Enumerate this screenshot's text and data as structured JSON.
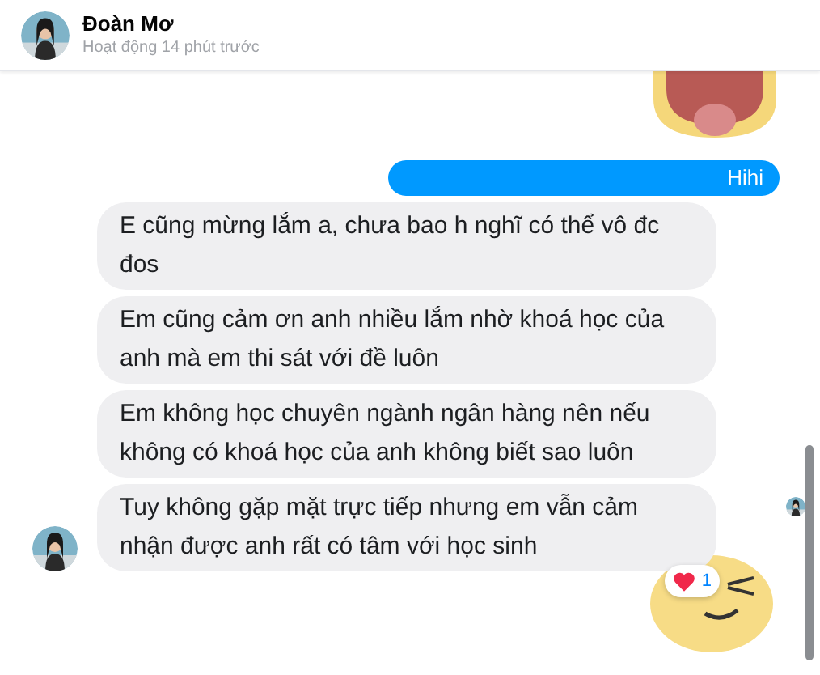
{
  "contact": {
    "name": "Đoàn Mơ",
    "status": "Hoạt động 14 phút trước"
  },
  "messages": [
    {
      "kind": "sticker"
    },
    {
      "kind": "sent",
      "text": "Hihi",
      "seen": false
    },
    {
      "kind": "received",
      "text": "E cũng mừng lắm a, chưa bao h nghĩ có thể vô đc đos",
      "seen": false
    },
    {
      "kind": "received",
      "text": "Em cũng cảm ơn anh nhiều lắm nhờ khoá học của anh mà em thi sát với đề luôn",
      "seen": false
    },
    {
      "kind": "received",
      "text": "Em không học chuyên ngành ngân hàng nên nếu không có khoá học của anh không biết sao luôn",
      "seen": false
    },
    {
      "kind": "received",
      "text": "Tuy không gặp mặt trực tiếp nhưng em vẫn cảm nhận được anh rất có tâm với học sinh",
      "seen": true,
      "reaction": {
        "count": "1"
      }
    },
    {
      "kind": "sticker"
    }
  ]
}
